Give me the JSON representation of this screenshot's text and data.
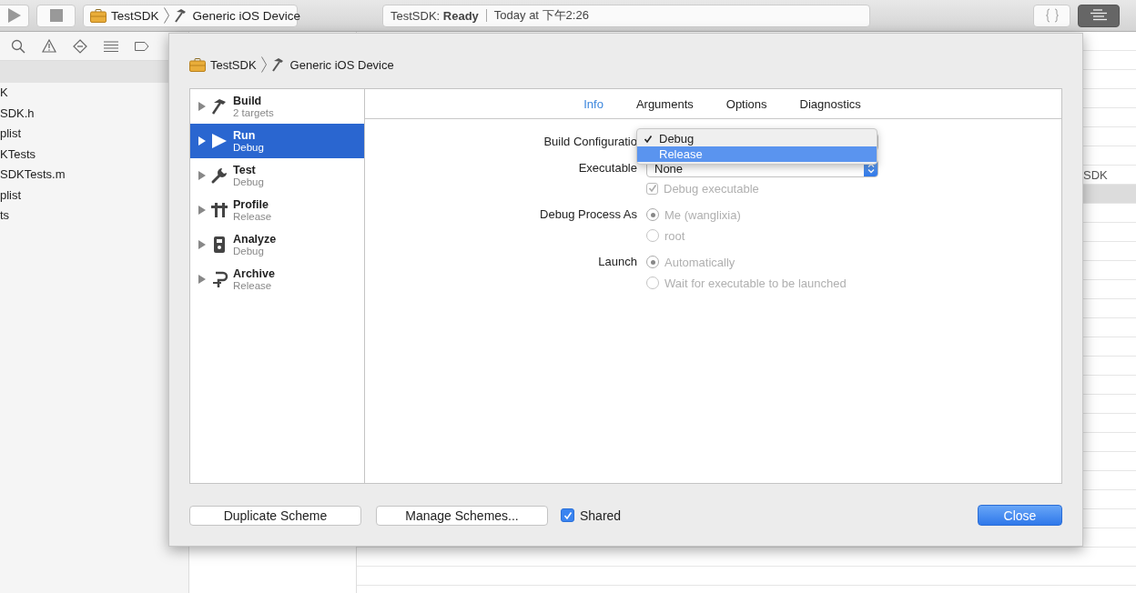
{
  "toolbar": {
    "scheme": {
      "project": "TestSDK",
      "device": "Generic iOS Device"
    },
    "status": {
      "activity": "TestSDK: **Ready**",
      "time": "Today at 下午2:26"
    }
  },
  "navigator": {
    "files": [
      "K",
      "SDK.h",
      "plist",
      "KTests",
      "SDKTests.m",
      "plist",
      "ts"
    ]
  },
  "editor": {
    "label": "SDK"
  },
  "dialog": {
    "breadcrumb": {
      "project": "TestSDK",
      "device": "Generic iOS Device"
    },
    "actions": [
      {
        "kind": "build",
        "name": "Build",
        "detail": "2 targets",
        "selected": false
      },
      {
        "kind": "run",
        "name": "Run",
        "detail": "Debug",
        "selected": true
      },
      {
        "kind": "test",
        "name": "Test",
        "detail": "Debug",
        "selected": false
      },
      {
        "kind": "profile",
        "name": "Profile",
        "detail": "Release",
        "selected": false
      },
      {
        "kind": "analyze",
        "name": "Analyze",
        "detail": "Debug",
        "selected": false
      },
      {
        "kind": "archive",
        "name": "Archive",
        "detail": "Release",
        "selected": false
      }
    ],
    "tabs": [
      {
        "label": "Info",
        "selected": true
      },
      {
        "label": "Arguments",
        "selected": false
      },
      {
        "label": "Options",
        "selected": false
      },
      {
        "label": "Diagnostics",
        "selected": false
      }
    ],
    "form": {
      "build_configuration": {
        "label": "Build Configuratio"
      },
      "menu": [
        {
          "label": "Debug",
          "checked": true,
          "highlighted": false
        },
        {
          "label": "Release",
          "checked": false,
          "highlighted": true
        }
      ],
      "executable": {
        "label": "Executable",
        "value": "None"
      },
      "debug_executable": {
        "label": "Debug executable",
        "checked": true,
        "disabled": true
      },
      "debug_process_as": {
        "label": "Debug Process As",
        "disabled": true,
        "options": [
          {
            "label": "Me (wanglixia)",
            "selected": true
          },
          {
            "label": "root",
            "selected": false
          }
        ]
      },
      "launch": {
        "label": "Launch",
        "disabled": true,
        "options": [
          {
            "label": "Automatically",
            "selected": true
          },
          {
            "label": "Wait for executable to be launched",
            "selected": false
          }
        ]
      }
    },
    "buttons": [
      "Duplicate Scheme",
      "Manage Schemes..."
    ],
    "shared": {
      "label": "Shared",
      "checked": true
    },
    "close": "Close"
  }
}
